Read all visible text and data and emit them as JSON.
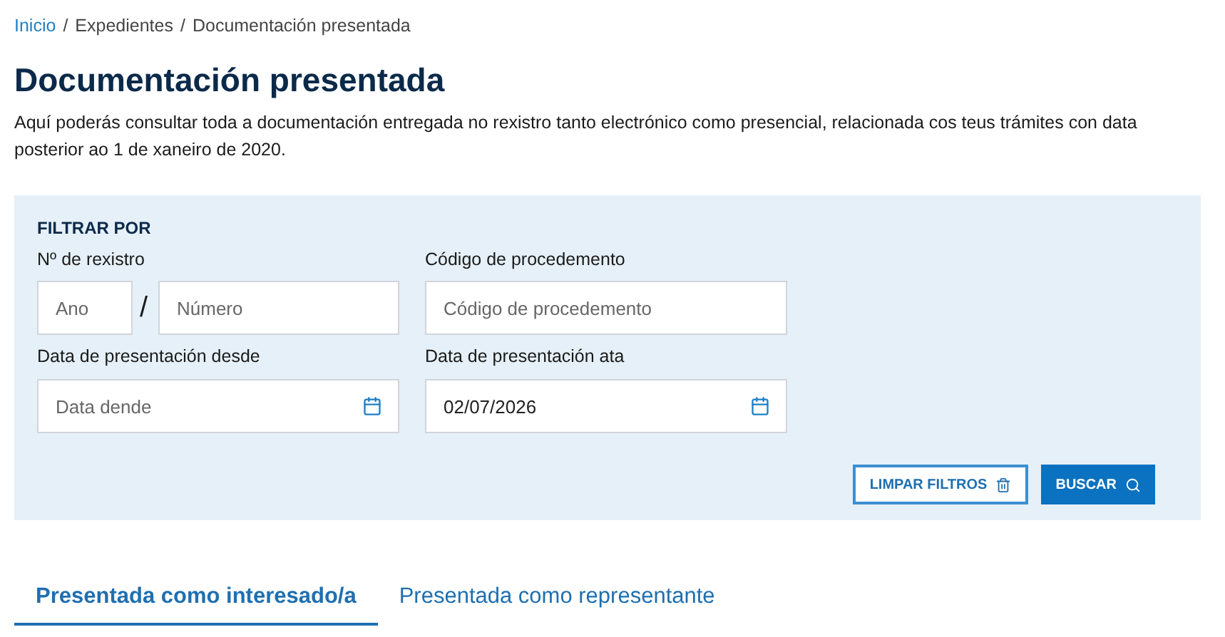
{
  "breadcrumb": [
    {
      "label": "Inicio",
      "link": true
    },
    {
      "label": "Expedientes",
      "link": false
    },
    {
      "label": "Documentación presentada",
      "link": false
    }
  ],
  "breadcrumb_separator": "/",
  "title": "Documentación presentada",
  "description": "Aquí poderás consultar toda a documentación entregada no rexistro tanto electrónico como presencial, relacionada cos teus trámites con data posterior ao 1 de xaneiro de 2020.",
  "filter": {
    "heading": "FILTRAR POR",
    "registry_label": "Nº de rexistro",
    "year": {
      "placeholder": "Ano"
    },
    "separator": "/",
    "number": {
      "placeholder": "Número"
    },
    "procedure": {
      "label": "Código de procedemento",
      "placeholder": "Código de procedemento"
    },
    "date_from": {
      "label": "Data de presentación desde",
      "placeholder": "Data dende"
    },
    "date_to": {
      "label": "Data de presentación ata",
      "value": "02/07/2026"
    },
    "clear_button": "LIMPAR FILTROS",
    "search_button": "BUSCAR"
  },
  "tabs": [
    {
      "label": "Presentada como interesado/a",
      "selected": true
    },
    {
      "label": "Presentada como representante",
      "selected": false
    }
  ]
}
